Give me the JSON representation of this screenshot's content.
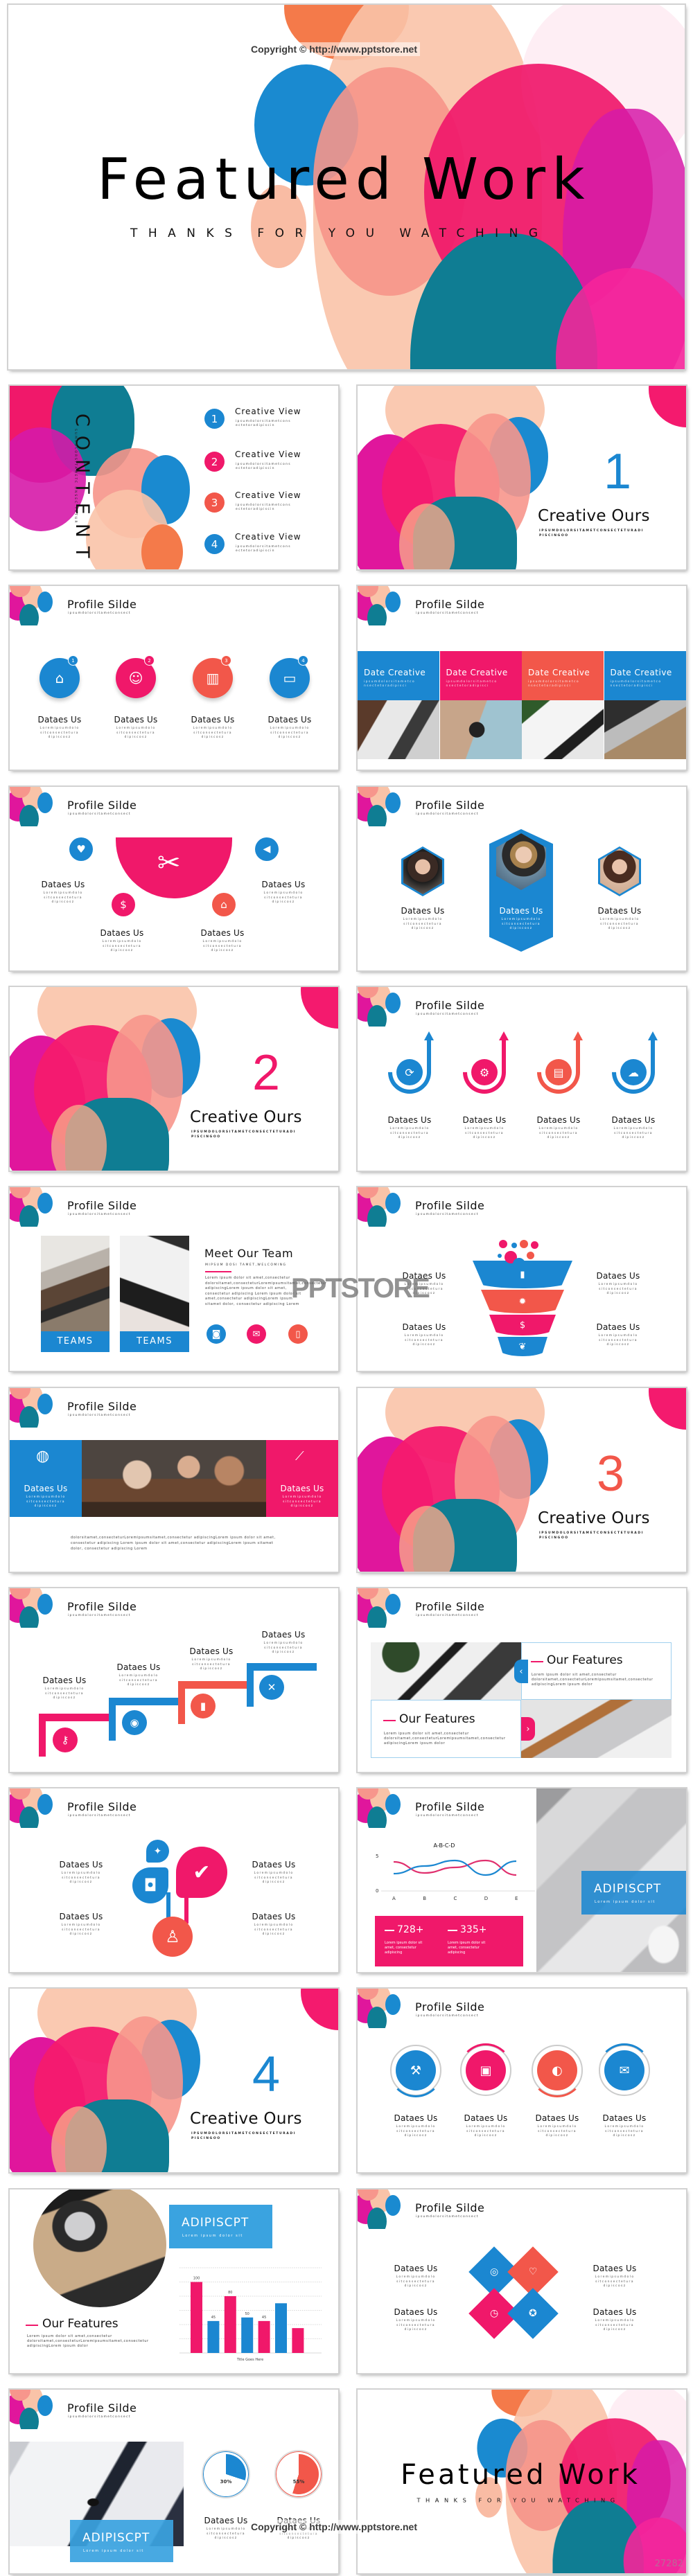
{
  "watermarks": {
    "copyright": "Copyright © http://www.pptstore.net",
    "store": "PPTSTORE",
    "code": "27282"
  },
  "palette": {
    "blue": "#1b87d1",
    "pink": "#f0186a",
    "coral": "#f2574a",
    "teal": "#0f7d93",
    "magenta": "#e0169c",
    "peach": "#f7b49a"
  },
  "common": {
    "profile_title": "Profile Silde",
    "profile_sub": "ipsumdolorsitametconsect",
    "item_title": "Dataes Us",
    "item_body": "Loremipsumdolo sitconsectetura dipiscosz",
    "section_title": "Creative Ours",
    "section_sub": "IPSUMDOLORSITAMETCONSECTETURADI PISCINGOO"
  },
  "cover": {
    "title": "Featured Work",
    "subtitle": "THANKS FOR YOU WATCHING"
  },
  "contents": {
    "heading": "CONTENT",
    "side_text": "SUMDOLORSITAMETC ONSEC TETUR",
    "items": [
      {
        "num": "1",
        "title": "Creative View",
        "body": "ipsumdolorsitametcons ectetoradipiscin",
        "color": "#1b87d1"
      },
      {
        "num": "2",
        "title": "Creative View",
        "body": "ipsumdolorsitametcons ectetoradipiscin",
        "color": "#f0186a"
      },
      {
        "num": "3",
        "title": "Creative View",
        "body": "ipsumdolorsitametcons ectetoradipiscin",
        "color": "#f2574a"
      },
      {
        "num": "4",
        "title": "Creative View",
        "body": "ipsumdolorsitametcons ectetoradipiscin",
        "color": "#1b87d1"
      }
    ]
  },
  "sections": [
    {
      "num": "1",
      "color": "#1b87d1"
    },
    {
      "num": "2",
      "color": "#f0186a"
    },
    {
      "num": "3",
      "color": "#f2574a"
    },
    {
      "num": "4",
      "color": "#1b87d1"
    }
  ],
  "badges": [
    "1",
    "2",
    "3",
    "4"
  ],
  "date_columns": {
    "title": "Date Creative",
    "body": "ipsumdolorsitametco nsectetoradipisci"
  },
  "team": {
    "title": "Meet Our Team",
    "subtitle": "MIPSUM DOSI TAMET,WELCOMING",
    "paragraph": "Lorem ipsum dolor sit amet,consectetur dolorsitamet,consecteturLoremipsumsitamet,consectetur adipiscingLorem ipsum dolor sit amet, consectetur adipiscing Lorem ipsum dolor sit amet,consectetur adipiscingLorem ipsum sitamet dolor, consectetur adipiscing Lorem",
    "button": "TEAMS"
  },
  "banner": {
    "paragraph": "dolorsitamet,consecteturLoremipsumsitamet,consectetur adipiscingLorem ipsum dolor sit amet, consectetur adipiscing Lorem ipsum dolor sit amet,consectetur adipiscingLorem ipsum sitamet dolor, consectetur adipiscing Lorem"
  },
  "features": {
    "title": "Our Features",
    "body": "Lorem ipsum dolor sit amet,consectetur dolorsitamet,consecteturLoremipsumsitamet,consectetur adipiscingLorem ipsum dolor"
  },
  "stats": [
    {
      "value": "728+",
      "body": "Lorem ipsum dolor sit amet, consectetur adipiscing"
    },
    {
      "value": "335+",
      "body": "Lorem ipsum dolor sit amet, consectetur adipiscing"
    }
  ],
  "promo": {
    "title": "ADIPISCPT",
    "body": "Lorem ipsum dolor sit"
  },
  "progress": [
    {
      "label": "30%",
      "value": 30,
      "color": "#1b87d1"
    },
    {
      "label": "55%",
      "value": 55,
      "color": "#f2574a"
    }
  ],
  "chart_data": [
    {
      "type": "line",
      "title": "A-B-C-D",
      "categories": [
        "A",
        "B",
        "C",
        "D",
        "E"
      ],
      "ylim": [
        0,
        5
      ],
      "yticks": [
        "5",
        "0"
      ],
      "series": [
        {
          "values": [
            4.2,
            2.6,
            3.4,
            4.4,
            2.3
          ],
          "color": "#e0306e"
        },
        {
          "values": [
            2.5,
            3.6,
            4.4,
            2.3,
            4.3
          ],
          "color": "#1b87d1"
        }
      ]
    },
    {
      "type": "bar",
      "xlabel": "Title Goes Here",
      "ylim": [
        0,
        120
      ],
      "grid": true,
      "values": [
        100,
        45,
        80,
        50,
        45,
        70,
        35
      ],
      "data_labels": [
        "100",
        "45",
        "80",
        "50",
        "45",
        "",
        ""
      ],
      "colors": [
        "#f0186a",
        "#1b87d1",
        "#f0186a",
        "#1b87d1",
        "#f0186a",
        "#1b87d1",
        "#f0186a"
      ]
    }
  ]
}
